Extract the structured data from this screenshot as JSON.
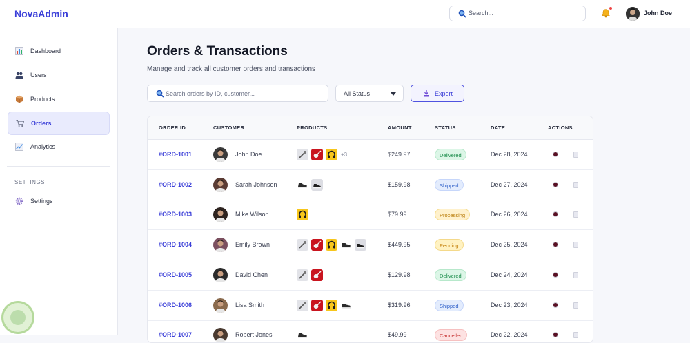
{
  "app": {
    "name": "NovaAdmin",
    "search_placeholder": "Search...",
    "user_name": "John Doe",
    "accent_color": "#3b3fd8"
  },
  "sidebar": {
    "items": [
      {
        "label": "Dashboard",
        "icon": "bar-chart-icon"
      },
      {
        "label": "Users",
        "icon": "users-icon"
      },
      {
        "label": "Products",
        "icon": "box-icon"
      },
      {
        "label": "Orders",
        "icon": "shopping-cart-icon",
        "active": true
      },
      {
        "label": "Analytics",
        "icon": "line-chart-icon"
      }
    ],
    "section_label": "SETTINGS",
    "settings_item": {
      "label": "Settings",
      "icon": "gear-icon"
    }
  },
  "page": {
    "title": "Orders & Transactions",
    "subtitle": "Manage and track all customer orders and transactions",
    "search_placeholder": "Search orders by ID, customer...",
    "status_filter": "All Status",
    "export_label": "Export"
  },
  "table": {
    "headers": [
      "ORDER ID",
      "CUSTOMER",
      "PRODUCTS",
      "AMOUNT",
      "STATUS",
      "DATE",
      "ACTIONS"
    ],
    "rows": [
      {
        "id": "#ORD-1001",
        "customer": "John Doe",
        "products": [
          "microphone",
          "guitar",
          "headphones"
        ],
        "more": "+3",
        "amount": "$249.97",
        "status": "Delivered",
        "date": "Dec 28, 2024"
      },
      {
        "id": "#ORD-1002",
        "customer": "Sarah Johnson",
        "products": [
          "shoe",
          "shoe-dark"
        ],
        "more": "",
        "amount": "$159.98",
        "status": "Shipped",
        "date": "Dec 27, 2024"
      },
      {
        "id": "#ORD-1003",
        "customer": "Mike Wilson",
        "products": [
          "headphones"
        ],
        "more": "",
        "amount": "$79.99",
        "status": "Processing",
        "date": "Dec 26, 2024"
      },
      {
        "id": "#ORD-1004",
        "customer": "Emily Brown",
        "products": [
          "microphone",
          "guitar",
          "headphones",
          "shoe",
          "shoe-dark"
        ],
        "more": "",
        "amount": "$449.95",
        "status": "Pending",
        "date": "Dec 25, 2024"
      },
      {
        "id": "#ORD-1005",
        "customer": "David Chen",
        "products": [
          "microphone",
          "guitar"
        ],
        "more": "",
        "amount": "$129.98",
        "status": "Delivered",
        "date": "Dec 24, 2024"
      },
      {
        "id": "#ORD-1006",
        "customer": "Lisa Smith",
        "products": [
          "microphone",
          "guitar",
          "headphones",
          "shoe"
        ],
        "more": "",
        "amount": "$319.96",
        "status": "Shipped",
        "date": "Dec 23, 2024"
      },
      {
        "id": "#ORD-1007",
        "customer": "Robert Jones",
        "products": [
          "shoe"
        ],
        "more": "",
        "amount": "$49.99",
        "status": "Cancelled",
        "date": "Dec 22, 2024"
      }
    ]
  },
  "status_colors": {
    "Delivered": {
      "bg": "#dcf6e7",
      "fg": "#178a48",
      "border": "#b7e8cb"
    },
    "Shipped": {
      "bg": "#e3ecfd",
      "fg": "#2f60c9",
      "border": "#c6d6fa"
    },
    "Processing": {
      "bg": "#fff1cc",
      "fg": "#b57600",
      "border": "#f6dd8f"
    },
    "Pending": {
      "bg": "#fff2c2",
      "fg": "#c07a00",
      "border": "#f4d98a"
    },
    "Cancelled": {
      "bg": "#fde2e2",
      "fg": "#c83838",
      "border": "#f6c0c0"
    }
  }
}
